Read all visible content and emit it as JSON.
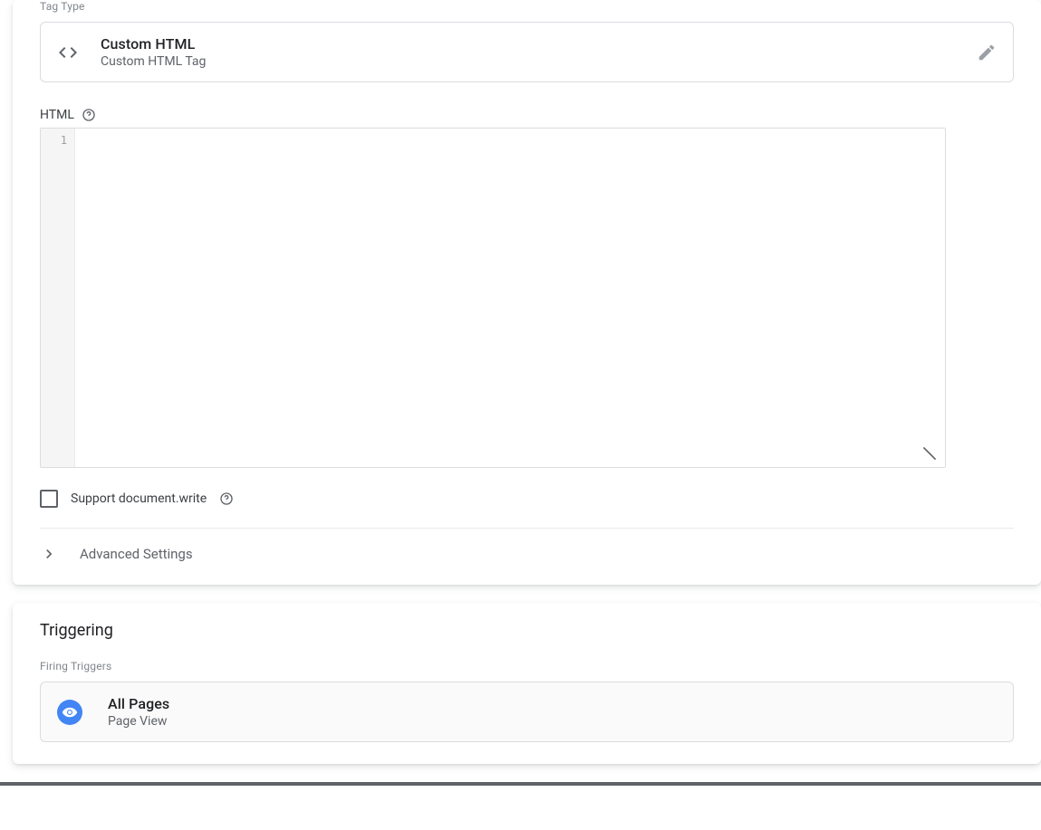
{
  "tag_config": {
    "section_label": "Tag Type",
    "type_title": "Custom HTML",
    "type_subtitle": "Custom HTML Tag",
    "html_label": "HTML",
    "editor_line_start": "1",
    "editor_value": "",
    "support_docwrite_label": "Support document.write",
    "advanced_label": "Advanced Settings"
  },
  "triggering": {
    "title": "Triggering",
    "section_label": "Firing Triggers",
    "trigger_title": "All Pages",
    "trigger_subtitle": "Page View"
  }
}
